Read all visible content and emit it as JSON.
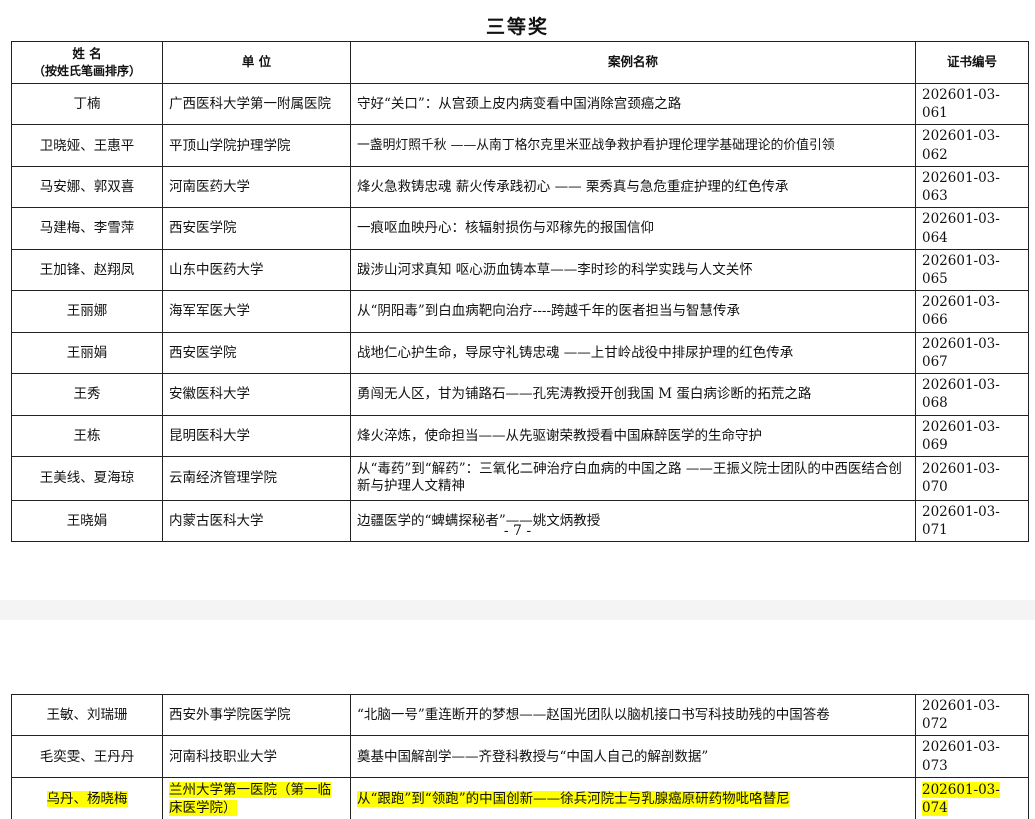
{
  "title": "三等奖",
  "headers": {
    "name": "姓 名",
    "name_sub": "（按姓氏笔画排序）",
    "unit": "单 位",
    "case": "案例名称",
    "cert": "证书编号"
  },
  "page1_rows": [
    {
      "name": "丁楠",
      "unit": "广西医科大学第一附属医院",
      "case": "守好“关口”：从宫颈上皮内病变看中国消除宫颈癌之路",
      "cert": "202601-03-061"
    },
    {
      "name": "卫晓娅、王惠平",
      "unit": "平顶山学院护理学院",
      "case": "一盏明灯照千秋 ——从南丁格尔克里米亚战争救护看护理伦理学基础理论的价值引领",
      "cert": "202601-03-062"
    },
    {
      "name": "马安娜、郭双喜",
      "unit": "河南医药大学",
      "case": "烽火急救铸忠魂 薪火传承践初心 —— 栗秀真与急危重症护理的红色传承",
      "cert": "202601-03-063"
    },
    {
      "name": "马建梅、李雪萍",
      "unit": "西安医学院",
      "case": "一痕呕血映丹心：核辐射损伤与邓稼先的报国信仰",
      "cert": "202601-03-064"
    },
    {
      "name": "王加锋、赵翔凤",
      "unit": "山东中医药大学",
      "case": "跋涉山河求真知 呕心沥血铸本草——李时珍的科学实践与人文关怀",
      "cert": "202601-03-065"
    },
    {
      "name": "王丽娜",
      "unit": "海军军医大学",
      "case": "从“阴阳毒”到白血病靶向治疗----跨越千年的医者担当与智慧传承",
      "cert": "202601-03-066"
    },
    {
      "name": "王丽娟",
      "unit": "西安医学院",
      "case": "战地仁心护生命，导尿守礼铸忠魂 ——上甘岭战役中排尿护理的红色传承",
      "cert": "202601-03-067"
    },
    {
      "name": "王秀",
      "unit": "安徽医科大学",
      "case": "勇闯无人区，甘为铺路石——孔宪涛教授开创我国 M 蛋白病诊断的拓荒之路",
      "cert": "202601-03-068"
    },
    {
      "name": "王栋",
      "unit": "昆明医科大学",
      "case": "烽火淬炼，使命担当——从先驱谢荣教授看中国麻醉医学的生命守护",
      "cert": "202601-03-069"
    },
    {
      "name": "王美线、夏海琼",
      "unit": "云南经济管理学院",
      "case": "从“毒药”到“解药”：三氧化二砷治疗白血病的中国之路 ——王振义院士团队的中西医结合创新与护理人文精神",
      "cert": "202601-03-070"
    },
    {
      "name": "王晓娟",
      "unit": "内蒙古医科大学",
      "case": "边疆医学的“蜱螨探秘者”——姚文炳教授",
      "cert": "202601-03-071"
    }
  ],
  "page_number": "- 7 -",
  "page2_rows": [
    {
      "name": "王敏、刘瑞珊",
      "unit": "西安外事学院医学院",
      "case": "“北脑一号”重连断开的梦想——赵国光团队以脑机接口书写科技助残的中国答卷",
      "cert": "202601-03-072",
      "highlight": false
    },
    {
      "name": "毛奕雯、王丹丹",
      "unit": "河南科技职业大学",
      "case": "奠基中国解剖学——齐登科教授与“中国人自己的解剖数据”",
      "cert": "202601-03-073",
      "highlight": false
    },
    {
      "name": "乌丹、杨晓梅",
      "unit": "兰州大学第一医院（第一临床医学院）",
      "case": "从“跟跑”到“领跑”的中国创新——徐兵河院士与乳腺癌原研药物吡咯替尼",
      "cert": "202601-03-074",
      "highlight": true
    }
  ],
  "highlight_color": "#ffff00"
}
